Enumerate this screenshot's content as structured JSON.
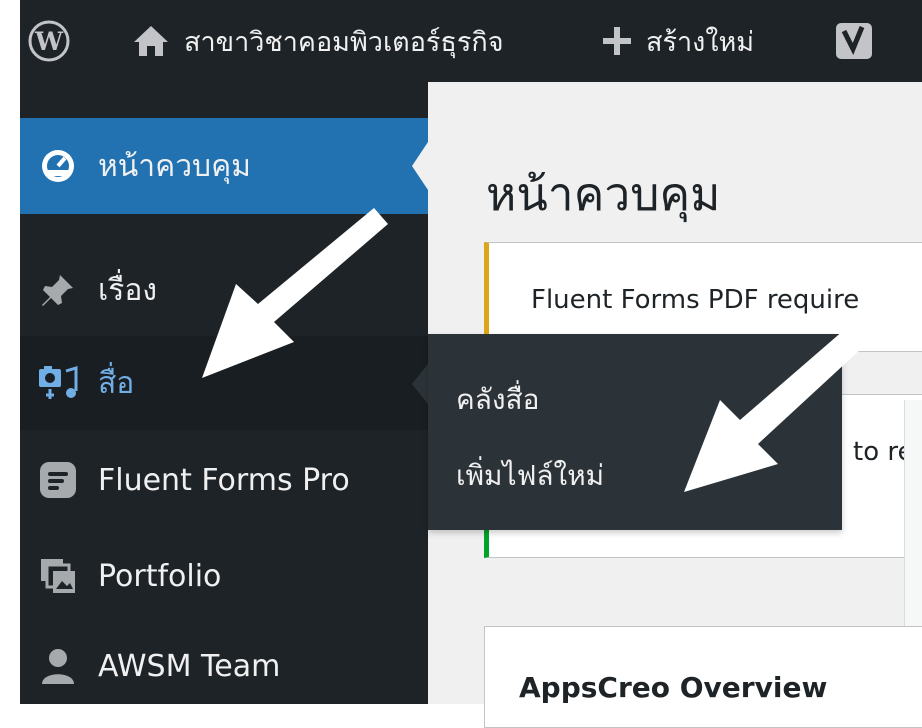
{
  "admin_bar": {
    "site_name": "สาขาวิชาคอมพิวเตอร์ธุรกิจ",
    "new_label": "สร้างใหม่",
    "icons": [
      "wordpress-logo-icon",
      "home-icon",
      "plus-icon",
      "yoast-icon"
    ]
  },
  "sidebar": {
    "items": [
      {
        "label": "หน้าควบคุม",
        "icon": "dashboard-gauge-icon",
        "state": "current"
      },
      {
        "label": "เรื่อง",
        "icon": "pin-icon"
      },
      {
        "label": "สื่อ",
        "icon": "media-icon",
        "state": "hover"
      },
      {
        "label": "Fluent Forms Pro",
        "icon": "fluent-forms-icon"
      },
      {
        "label": "Portfolio",
        "icon": "portfolio-icon"
      },
      {
        "label": "AWSM Team",
        "icon": "user-icon"
      }
    ]
  },
  "submenu": {
    "items": [
      {
        "label": "คลังสื่อ"
      },
      {
        "label": "เพิ่มไฟล์ใหม่"
      }
    ]
  },
  "main": {
    "title": "หน้าควบคุม",
    "notice_1_text": "Fluent Forms PDF require",
    "notice_2_text": "to re",
    "panel_title": "AppsCreo Overview"
  },
  "colors": {
    "admin_bar_bg": "#1d2327",
    "menu_current_bg": "#2271b1",
    "submenu_bg": "#2c3338",
    "media_accent": "#72aee6",
    "notice_warning": "#dba617",
    "notice_success": "#00a32a"
  }
}
